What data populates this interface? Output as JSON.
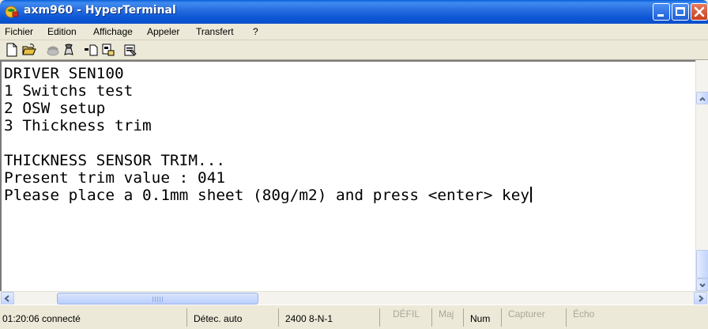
{
  "window": {
    "title": "axm960 - HyperTerminal",
    "icon": "hyperterminal-app-icon"
  },
  "menubar": {
    "items": [
      "Fichier",
      "Edition",
      "Affichage",
      "Appeler",
      "Transfert",
      "?"
    ]
  },
  "toolbar": {
    "icons": [
      "new-document-icon",
      "open-folder-icon",
      "dial-phone-icon",
      "hang-up-icon",
      "send-icon",
      "receive-icon",
      "properties-icon"
    ]
  },
  "terminal": {
    "lines": [
      "DRIVER SEN100",
      "1 Switchs test",
      "2 OSW setup",
      "3 Thickness trim",
      "",
      "THICKNESS SENSOR TRIM...",
      "Present trim value : 041",
      "Please place a 0.1mm sheet (80g/m2) and press <enter> key"
    ]
  },
  "statusbar": {
    "connection": "01:20:06 connecté",
    "detect": "Détec. auto",
    "settings": "2400 8-N-1",
    "scroll": "DÉFIL",
    "caps": "Maj",
    "num": "Num",
    "capture": "Capturer",
    "echo": "Écho"
  },
  "colors": {
    "titlebar": "#0a5fd8",
    "close_button": "#c8401e",
    "terminal_background": "#ffffff",
    "terminal_text": "#000000",
    "chrome": "#ece9d8"
  }
}
